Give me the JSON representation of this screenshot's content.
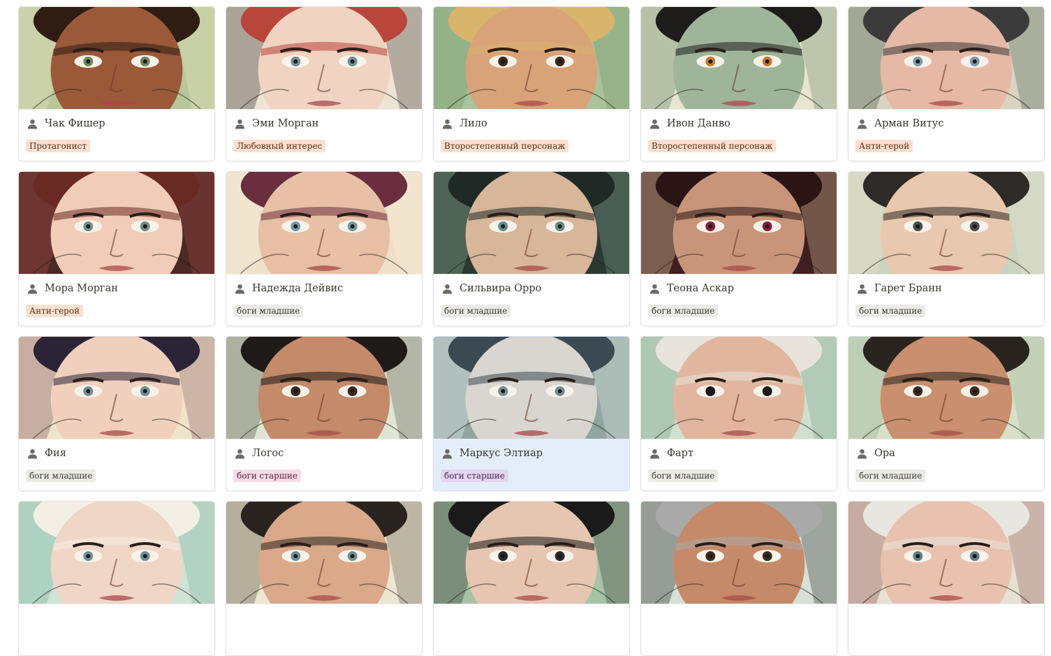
{
  "cards": [
    {
      "name": "Чак Фишер",
      "tag": "Протагонист",
      "tag_color": "orange",
      "bg": "#b8c79a",
      "skin": "#9a5a3a",
      "hair": "#2f1d14",
      "eye": "#6b8a5a",
      "accent": "#efe6c4"
    },
    {
      "name": "Эми Морган",
      "tag": "Любовный интерес",
      "tag_color": "orange",
      "bg": "#efe3d3",
      "skin": "#f0d3c1",
      "hair": "#b9463b",
      "eye": "#6f8f95",
      "accent": "#2b2b2b"
    },
    {
      "name": "Лило",
      "tag": "Второстепенный персонаж",
      "tag_color": "orange",
      "bg": "#a9c39a",
      "skin": "#d9a37a",
      "hair": "#d7b56a",
      "eye": "#3a2a1e",
      "accent": "#6f8e66"
    },
    {
      "name": "Ивон Данво",
      "tag": "Второстепенный персонаж",
      "tag_color": "orange",
      "bg": "#e8e6cf",
      "skin": "#9fb59a",
      "hair": "#1e1c1a",
      "eye": "#c87a2a",
      "accent": "#5d7a5f"
    },
    {
      "name": "Арман Витус",
      "tag": "Анти-герой",
      "tag_color": "orange",
      "bg": "#d9d4c2",
      "skin": "#e6b9a6",
      "hair": "#3b3b3b",
      "eye": "#7d9aa6",
      "accent": "#405645"
    },
    {
      "name": "Мора Морган",
      "tag": "Анти-герой",
      "tag_color": "orange",
      "bg": "#4a2a24",
      "skin": "#f1cdb9",
      "hair": "#6a2a24",
      "eye": "#6f8f8a",
      "accent": "#b24a4a"
    },
    {
      "name": "Надежда Дейвис",
      "tag": "боги младшие",
      "tag_color": "gray",
      "bg": "#efe1c9",
      "skin": "#e8c0a6",
      "hair": "#6a2e3e",
      "eye": "#6f9aa3",
      "accent": "#f5eedc"
    },
    {
      "name": "Сильвира Орро",
      "tag": "боги младшие",
      "tag_color": "gray",
      "bg": "#2a3a33",
      "skin": "#d8b69a",
      "hair": "#1f2a26",
      "eye": "#5f8f88",
      "accent": "#8fb49c"
    },
    {
      "name": "Теона Аскар",
      "tag": "боги младшие",
      "tag_color": "gray",
      "bg": "#3f1f22",
      "skin": "#c9957a",
      "hair": "#2a1414",
      "eye": "#8a1f3a",
      "accent": "#e8d6a6"
    },
    {
      "name": "Гарет Бранн",
      "tag": "боги младшие",
      "tag_color": "gray",
      "bg": "#c9d3bf",
      "skin": "#e8c8ae",
      "hair": "#2e2a27",
      "eye": "#4b4b4b",
      "accent": "#f0e6d2"
    },
    {
      "name": "Фия",
      "tag": "боги младшие",
      "tag_color": "gray",
      "bg": "#efe3c9",
      "skin": "#f0d0bd",
      "hair": "#2b2436",
      "eye": "#6f8f95",
      "accent": "#7a4a5a"
    },
    {
      "name": "Логос",
      "tag": "боги старшие",
      "tag_color": "pink",
      "bg": "#dfe6d6",
      "skin": "#c48a6a",
      "hair": "#1e1a17",
      "eye": "#3b2a20",
      "accent": "#4e4a3a"
    },
    {
      "name": "Маркус Элтиар",
      "tag": "боги старшие",
      "tag_color": "purple",
      "bg": "#8fa6a1",
      "skin": "#d9d5d1",
      "hair": "#3b4a52",
      "eye": "#6f8f9a",
      "accent": "#f2f2ee",
      "selected": true
    },
    {
      "name": "Фарт",
      "tag": "боги младшие",
      "tag_color": "gray",
      "bg": "#cfe0cf",
      "skin": "#e2b69e",
      "hair": "#e8e4dc",
      "eye": "#1a1a1a",
      "accent": "#6f9a7f"
    },
    {
      "name": "Ора",
      "tag": "боги младшие",
      "tag_color": "gray",
      "bg": "#d9dfc8",
      "skin": "#c98f6e",
      "hair": "#2a2420",
      "eye": "#3a2a20",
      "accent": "#8fb296"
    },
    {
      "name": "",
      "tag": "",
      "tag_color": "gray",
      "bg": "#cfe3d6",
      "skin": "#f0d6c6",
      "hair": "#f4efe4",
      "eye": "#6f8f95",
      "accent": "#6fb19a"
    },
    {
      "name": "",
      "tag": "",
      "tag_color": "gray",
      "bg": "#efe6d2",
      "skin": "#d9a98a",
      "hair": "#2a2420",
      "eye": "#6f8f95",
      "accent": "#4a4a3a"
    },
    {
      "name": "",
      "tag": "",
      "tag_color": "gray",
      "bg": "#a6c3a6",
      "skin": "#e6c6b0",
      "hair": "#1a1a1a",
      "eye": "#2a2a2a",
      "accent": "#2a2a2a"
    },
    {
      "name": "",
      "tag": "",
      "tag_color": "gray",
      "bg": "#d6e0d6",
      "skin": "#c58a6a",
      "hair": "#a9a9a9",
      "eye": "#3b2a20",
      "accent": "#1f1f1f"
    },
    {
      "name": "",
      "tag": "",
      "tag_color": "gray",
      "bg": "#e6e1d2",
      "skin": "#e8c2ae",
      "hair": "#e8e6e0",
      "eye": "#5f7f85",
      "accent": "#8a4a4a"
    }
  ]
}
